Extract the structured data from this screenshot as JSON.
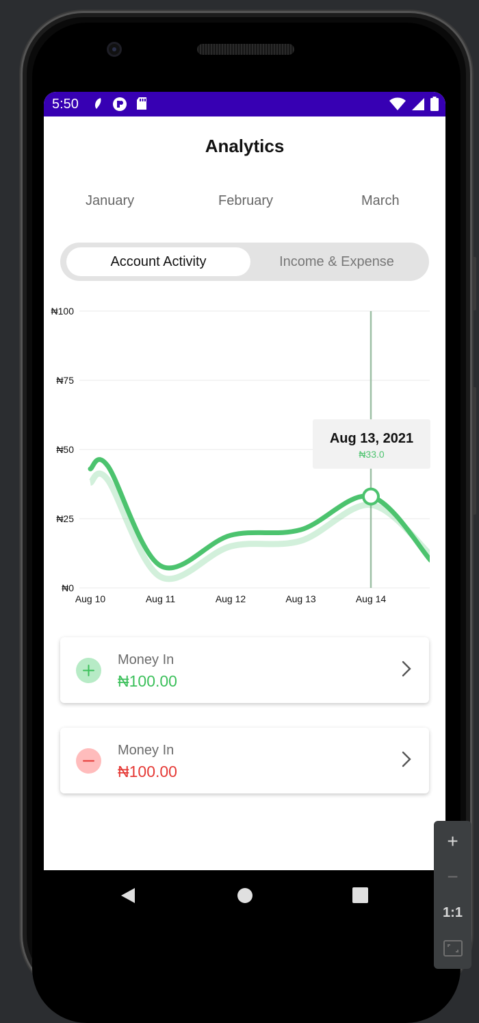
{
  "status_bar": {
    "time": "5:50",
    "color": "#3700b3"
  },
  "page": {
    "title": "Analytics"
  },
  "months": [
    "January",
    "February",
    "March"
  ],
  "tabs": [
    {
      "label": "Account Activity",
      "active": true
    },
    {
      "label": "Income & Expense",
      "active": false
    }
  ],
  "chart_data": {
    "type": "line",
    "y_tick_labels": [
      "₦100",
      "₦75",
      "₦50",
      "₦25",
      "₦0"
    ],
    "x_tick_labels": [
      "Aug 10",
      "Aug 11",
      "Aug 12",
      "Aug 13",
      "Aug 14"
    ],
    "ylim": [
      0,
      100
    ],
    "x": [
      0.0,
      0.25,
      1.0,
      2.0,
      3.0,
      4.0,
      4.85
    ],
    "values": [
      43,
      44,
      8,
      19,
      21,
      33,
      10
    ],
    "shadow_values": [
      38,
      39,
      4,
      15,
      17,
      30,
      12
    ],
    "selected_index": 5,
    "tooltip": {
      "date": "Aug 13, 2021",
      "value": "₦33.0"
    },
    "line_color": "#4cc36e",
    "grid": true
  },
  "cards": [
    {
      "label": "Money In",
      "amount": "₦100.00",
      "kind": "in",
      "icon": "plus-icon",
      "amount_color": "#3cc05b",
      "icon_bg": "#b7ebc6",
      "icon_color": "#3cc05b"
    },
    {
      "label": "Money In",
      "amount": "₦100.00",
      "kind": "out",
      "icon": "minus-icon",
      "amount_color": "#e53935",
      "icon_bg": "#ffbcbc",
      "icon_color": "#e53935"
    }
  ],
  "zoom_controls": [
    "+",
    "−",
    "1:1"
  ]
}
